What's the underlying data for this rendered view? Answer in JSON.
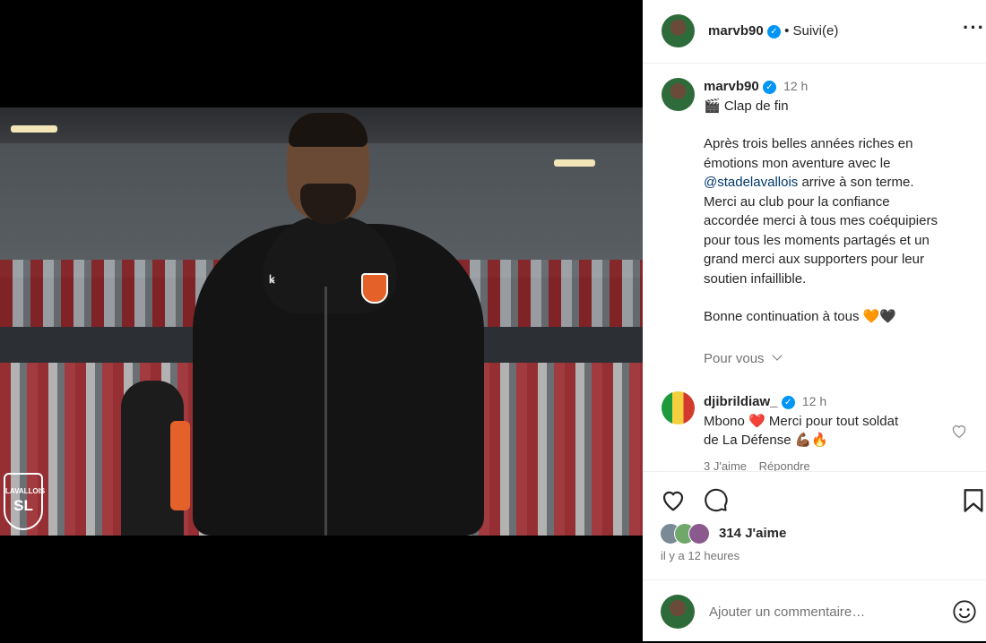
{
  "post": {
    "username": "marvb90",
    "follow_status": "Suivi(e)",
    "more_icon": "more-horizontal-icon",
    "caption_time": "12 h",
    "caption_line1": "🎬 Clap de fin",
    "caption_p1_a": "Après trois belles années riches en",
    "caption_p1_b": "émotions mon aventure avec le",
    "caption_mention": "@stadelavallois",
    "caption_p1_c": " arrive à son terme.",
    "caption_p1_d": "Merci au club pour la confiance",
    "caption_p1_e": "accordée merci à tous mes coéquipiers",
    "caption_p1_f": "pour tous les moments partagés et un",
    "caption_p1_g": "grand merci aux supporters pour leur",
    "caption_p1_h": "soutien infaillible.",
    "caption_p2": "Bonne continuation à tous 🧡🖤",
    "translate_label": "Pour vous",
    "likes_text": "314 J'aime",
    "posted_time": "il y a 12 heures",
    "comment_placeholder": "Ajouter un commentaire…"
  },
  "comment": {
    "username": "djibrildiaw_",
    "time": "12 h",
    "text_line1": "Mbono ❤️ Merci pour tout soldat",
    "text_line2": "de La Défense 💪🏾🔥",
    "likes": "3 J'aime",
    "reply": "Répondre"
  },
  "colors": {
    "verified": "#0095f6",
    "link": "#00376b",
    "muted": "#737373",
    "text": "#262626"
  }
}
